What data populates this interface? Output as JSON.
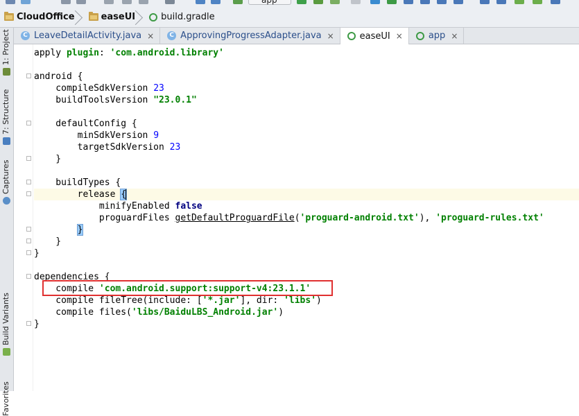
{
  "toolbar": {
    "run_config": "app",
    "icons": [
      "save-icon",
      "sync-icon",
      "undo-icon",
      "redo-icon",
      "run-icon",
      "debug-icon",
      "sdk-manager-icon"
    ]
  },
  "breadcrumb": {
    "items": [
      "CloudOffice",
      "easeUI",
      "build.gradle"
    ]
  },
  "tabs": [
    {
      "label": "LeaveDetailActivity.java",
      "icon": "class-icon",
      "close": "×"
    },
    {
      "label": "ApprovingProgressAdapter.java",
      "icon": "class-icon",
      "close": "×"
    },
    {
      "label": "easeUI",
      "icon": "gradle-icon",
      "close": "×"
    },
    {
      "label": "app",
      "icon": "gradle-icon",
      "close": "×"
    }
  ],
  "left_tools": [
    "1: Project",
    "7: Structure",
    "Captures",
    "Build Variants",
    "Favorites"
  ],
  "code": {
    "l1": {
      "a": "apply ",
      "b": "plugin",
      "c": ": ",
      "d": "'com.android.library'"
    },
    "l3": {
      "a": "android {"
    },
    "l4": {
      "a": "    compileSdkVersion ",
      "b": "23"
    },
    "l5": {
      "a": "    buildToolsVersion ",
      "b": "\"23.0.1\""
    },
    "l7": {
      "a": "    defaultConfig {"
    },
    "l8": {
      "a": "        minSdkVersion ",
      "b": "9"
    },
    "l9": {
      "a": "        targetSdkVersion ",
      "b": "23"
    },
    "l10": {
      "a": "    }"
    },
    "l12": {
      "a": "    buildTypes {"
    },
    "l13": {
      "a": "        release ",
      "b": "{"
    },
    "l14": {
      "a": "            minifyEnabled ",
      "b": "false"
    },
    "l15": {
      "a": "            proguardFiles ",
      "b": "getDefaultProguardFile",
      "c": "(",
      "d": "'proguard-android.txt'",
      "e": "), ",
      "f": "'proguard-rules.txt'"
    },
    "l16": {
      "a": "        ",
      "b": "}"
    },
    "l17": {
      "a": "    }"
    },
    "l18": {
      "a": "}"
    },
    "l20": {
      "a": "dependencies {"
    },
    "l21": {
      "a": "    compile ",
      "b": "'com.android.support:support-v4:23.1.1'"
    },
    "l22": {
      "a": "    compile fileTree(include: [",
      "b": "'*.jar'",
      "c": "], dir: ",
      "d": "'libs'",
      "e": ")"
    },
    "l23": {
      "a": "    compile files(",
      "b": "'libs/BaiduLBS_Android.jar'",
      "c": ")"
    },
    "l24": {
      "a": "}"
    }
  },
  "colors": {
    "string": "#008000",
    "number": "#0000ff",
    "keyword": "#000080",
    "highlight_box": "#e03030",
    "current_line": "#fdfae6"
  }
}
